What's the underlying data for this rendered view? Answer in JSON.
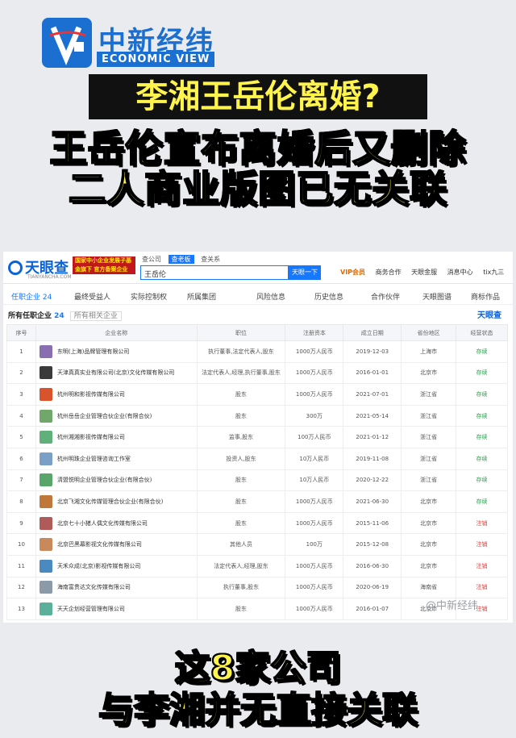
{
  "brand": {
    "cn": "中新经纬",
    "en": "ECONOMIC VIEW"
  },
  "headline": {
    "line1": "李湘王岳伦离婚?",
    "line2": "王岳伦宣布离婚后又删除",
    "line3": "二人商业版图已无关联"
  },
  "tyc": {
    "logo": "天眼查",
    "site": "TIANYANCHA.COM",
    "banner": "国家中小企业发展子基金旗下 官方备案企业征信机构",
    "search_tabs": [
      "查公司",
      "查老板",
      "查关系"
    ],
    "search_value": "王岳伦",
    "search_button": "天眼一下",
    "top_nav": [
      "VIP会员",
      "商务合作",
      "天眼金服",
      "消息中心",
      "tix九三"
    ],
    "subnav": [
      "任职企业 24",
      "最终受益人",
      "实际控制权",
      "所属集团",
      "风险信息",
      "历史信息",
      "合作伙伴",
      "天眼图谱",
      "商标作品"
    ],
    "section_title": "所有任职企业",
    "section_count": "24",
    "section_sub": "所有相关企业",
    "logo_small": "天眼查",
    "columns": [
      "序号",
      "企业名称",
      "职位",
      "注册资本",
      "成立日期",
      "省份地区",
      "经营状态"
    ],
    "rows": [
      {
        "no": "1",
        "name": "东明(上海)品牌管理有限公司",
        "role": "执行董事,法定代表人,股东",
        "capital": "1000万人民币",
        "date": "2019-12-03",
        "region": "上海市",
        "status": "存续",
        "color": "#8a6fb0"
      },
      {
        "no": "2",
        "name": "天津真真实业有限公司(北京)文化传媒有限公司",
        "role": "法定代表人,经理,执行董事,股东",
        "capital": "1000万人民币",
        "date": "2016-01-01",
        "region": "北京市",
        "status": "存续",
        "color": "#3a3a3a"
      },
      {
        "no": "3",
        "name": "杭州明和影视传媒有限公司",
        "role": "股东",
        "capital": "1000万人民币",
        "date": "2021-07-01",
        "region": "浙江省",
        "status": "存续",
        "color": "#d9532c"
      },
      {
        "no": "4",
        "name": "杭州岳岳企业管理合伙企业(有限合伙)",
        "role": "股东",
        "capital": "300万",
        "date": "2021-05-14",
        "region": "浙江省",
        "status": "存续",
        "color": "#6fa86a"
      },
      {
        "no": "5",
        "name": "杭州湘湘影视传媒有限公司",
        "role": "监事,股东",
        "capital": "100万人民币",
        "date": "2021-01-12",
        "region": "浙江省",
        "status": "存续",
        "color": "#5fb07a"
      },
      {
        "no": "6",
        "name": "杭州明珠企业管理咨询工作室",
        "role": "投资人,股东",
        "capital": "10万人民币",
        "date": "2019-11-08",
        "region": "浙江省",
        "status": "存续",
        "color": "#7aa0c8"
      },
      {
        "no": "7",
        "name": "清盟悦明企业管理合伙企业(有限合伙)",
        "role": "股东",
        "capital": "10万人民币",
        "date": "2020-12-22",
        "region": "浙江省",
        "status": "存续",
        "color": "#5aa56a"
      },
      {
        "no": "8",
        "name": "北京飞湘文化传媒管理合伙企业(有限合伙)",
        "role": "股东",
        "capital": "1000万人民币",
        "date": "2021-06-30",
        "region": "北京市",
        "status": "存续",
        "color": "#c0783a"
      },
      {
        "no": "9",
        "name": "北京七十小猪人偶文化传媒有限公司",
        "role": "股东",
        "capital": "1000万人民币",
        "date": "2015-11-06",
        "region": "北京市",
        "status": "注销",
        "color": "#b05a5a"
      },
      {
        "no": "10",
        "name": "北京巴黑幕影视文化传媒有限公司",
        "role": "其他人员",
        "capital": "100万",
        "date": "2015-12-08",
        "region": "北京市",
        "status": "注销",
        "color": "#c88a5a"
      },
      {
        "no": "11",
        "name": "天禾众成(北京)影视传媒有限公司",
        "role": "法定代表人,经理,股东",
        "capital": "1000万人民币",
        "date": "2016-06-30",
        "region": "北京市",
        "status": "注销",
        "color": "#4a8ac0"
      },
      {
        "no": "12",
        "name": "海南富贵达文化传媒有限公司",
        "role": "执行董事,股东",
        "capital": "1000万人民币",
        "date": "2020-06-19",
        "region": "海南省",
        "status": "注销",
        "color": "#8a9aa8"
      },
      {
        "no": "13",
        "name": "天天企划经营管理有限公司",
        "role": "股东",
        "capital": "1000万人民币",
        "date": "2016-01-07",
        "region": "北京市",
        "status": "注销",
        "color": "#5ab09a"
      }
    ]
  },
  "watermark": "@中新经纬",
  "bottom": {
    "line1": "这8家公司",
    "line2": "与李湘并无直接关联"
  }
}
